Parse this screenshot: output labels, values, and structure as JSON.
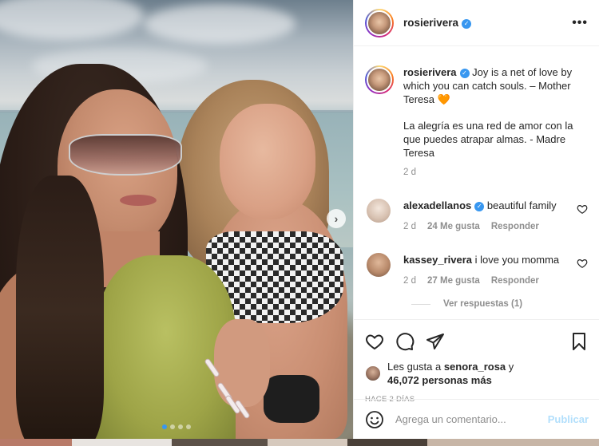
{
  "post": {
    "username": "rosierivera",
    "caption_user": "rosierivera",
    "caption_line1": " Joy is a net of love by which you can catch souls. – Mother Teresa 🧡",
    "caption_line2": "La alegría es una red de amor con la que puedes atrapar almas. - Madre Teresa",
    "caption_age": "2 d",
    "more_icon": "•••",
    "next_icon": "›"
  },
  "comments": [
    {
      "user": "alexadellanos",
      "verified": true,
      "text": " beautiful family",
      "age": "2 d",
      "likes": "24 Me gusta",
      "reply": "Responder",
      "avatar_color": "#e9dcd2"
    },
    {
      "user": "kassey_rivera",
      "verified": false,
      "text": " i love you momma",
      "age": "2 d",
      "likes": "27 Me gusta",
      "reply": "Responder",
      "avatar_color": "#c79a7c"
    }
  ],
  "view_replies": "Ver respuestas (1)",
  "likes": {
    "prefix": "Les gusta a ",
    "user": "senora_rosa",
    "mid": " y",
    "count": "46,072 personas más"
  },
  "timestamp": "HACE 2 DÍAS",
  "add_comment": {
    "placeholder": "Agrega un comentario...",
    "publish": "Publicar"
  },
  "colors": {
    "accent": "#3897f0",
    "publish_disabled": "#b2dffc",
    "muted": "#8e8e8e"
  }
}
